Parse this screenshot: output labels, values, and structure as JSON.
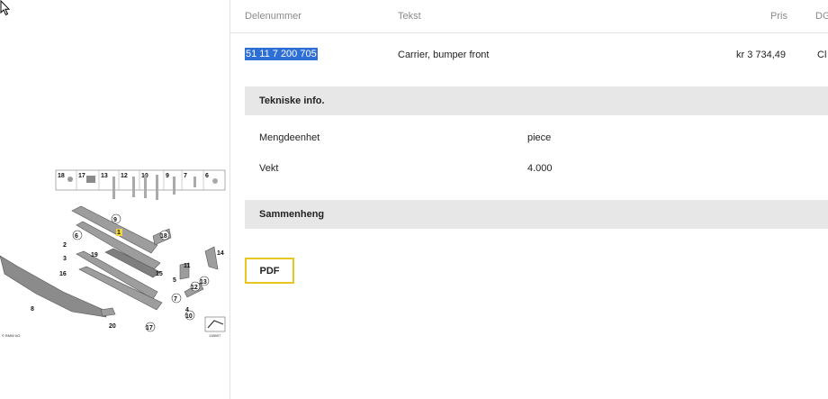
{
  "table": {
    "headers": {
      "part_number": "Delenummer",
      "text": "Tekst",
      "price": "Pris",
      "dg": "DG"
    },
    "row": {
      "part_number": "51 11 7 200 705",
      "text": "Carrier, bumper front",
      "price": "kr 3 734,49",
      "dg": "Cl"
    }
  },
  "technical_info": {
    "title": "Tekniske info.",
    "rows": [
      {
        "label": "Mengdeenhet",
        "value": "piece"
      },
      {
        "label": "Vekt",
        "value": "4.000"
      }
    ]
  },
  "relations": {
    "title": "Sammenheng"
  },
  "pdf_button": {
    "label": "PDF"
  },
  "diagram": {
    "callouts_top": [
      "18",
      "17",
      "13",
      "12",
      "10",
      "9",
      "7",
      "6"
    ],
    "callouts": [
      "9",
      "1",
      "18",
      "6",
      "2",
      "19",
      "3",
      "16",
      "11",
      "15",
      "5",
      "13",
      "12",
      "7",
      "4",
      "10",
      "14",
      "8",
      "20",
      "17"
    ],
    "brand_text": "© BMW AG",
    "image_id": "138907"
  },
  "colors": {
    "selection": "#2e6fd6",
    "section_bg": "#e7e7e7",
    "pdf_border": "#e8c51f"
  }
}
